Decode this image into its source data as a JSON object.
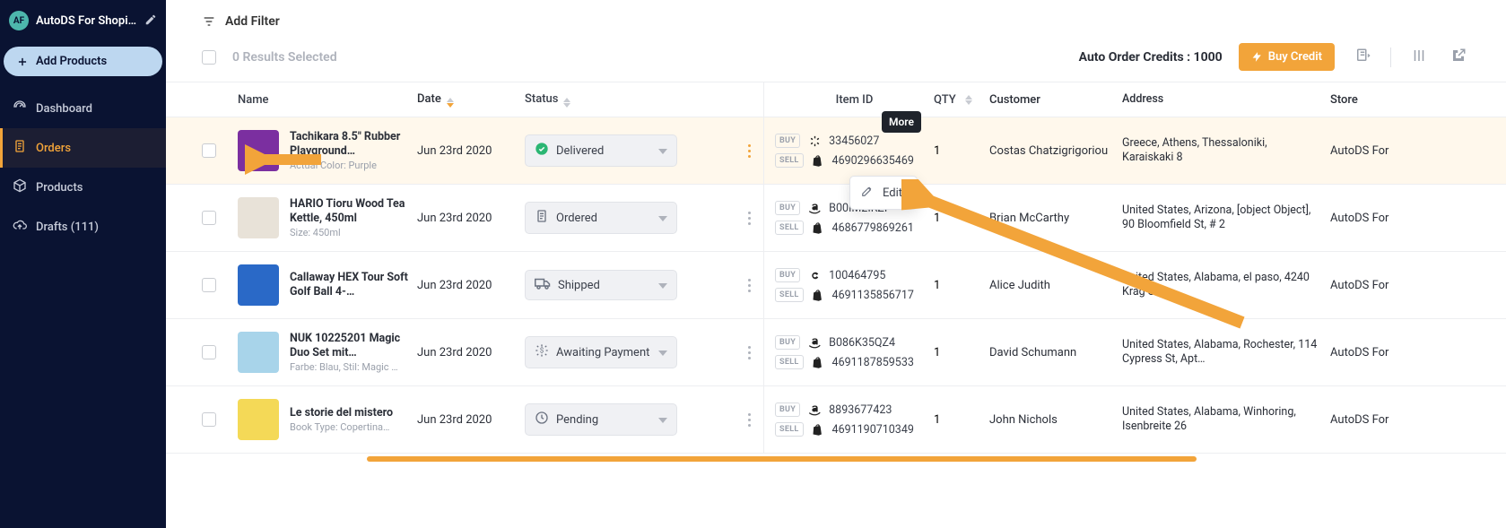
{
  "sidebar": {
    "store_avatar": "AF",
    "store_name": "AutoDS For Shopif...",
    "add_products": "Add Products",
    "items": [
      {
        "label": "Dashboard"
      },
      {
        "label": "Orders"
      },
      {
        "label": "Products"
      },
      {
        "label": "Drafts (111)"
      }
    ]
  },
  "toolbar": {
    "add_filter": "Add Filter",
    "results_selected": "0 Results Selected",
    "credits_label": "Auto Order Credits : 1000",
    "buy_credit": "Buy Credit"
  },
  "tooltip_more": "More",
  "popover_edit": "Edit",
  "columns": {
    "name": "Name",
    "date": "Date",
    "status": "Status",
    "item_id": "Item ID",
    "qty": "QTY",
    "customer": "Customer",
    "address": "Address",
    "store": "Store"
  },
  "tags": {
    "buy": "BUY",
    "sell": "SELL"
  },
  "rows": [
    {
      "name": "Tachikara 8.5\" Rubber Playground…",
      "meta": "Actual Color: Purple",
      "date": "Jun 23rd 2020",
      "status": "Delivered",
      "status_type": "delivered",
      "buy_source": "walmart",
      "buy_id": "33456027",
      "sell_id": "4690296635469",
      "qty": "1",
      "customer": "Costas Chatzigrigoriou",
      "address": "Greece, Athens, Thessaloniki, Karaiskaki 8",
      "store": "AutoDS For",
      "thumb_color": "#7b2fa0"
    },
    {
      "name": "HARIO Tioru Wood Tea Kettle, 450ml",
      "meta": "Size: 450ml",
      "date": "Jun 23rd 2020",
      "status": "Ordered",
      "status_type": "ordered",
      "buy_source": "amazon",
      "buy_id": "B00IM2IRZI",
      "sell_id": "4686779869261",
      "qty": "1",
      "customer": "Brian McCarthy",
      "address": "United States, Arizona, [object Object], 90 Bloomfield St, # 2",
      "store": "AutoDS For",
      "thumb_color": "#e8e2d8"
    },
    {
      "name": "Callaway HEX Tour Soft Golf Ball 4-…",
      "meta": "",
      "date": "Jun 23rd 2020",
      "status": "Shipped",
      "status_type": "shipped",
      "buy_source": "chewy",
      "buy_id": "100464795",
      "sell_id": "4691135856717",
      "qty": "1",
      "customer": "Alice Judith",
      "address": "United States, Alabama, el paso, 4240 Krag St",
      "store": "AutoDS For",
      "thumb_color": "#2a69c7"
    },
    {
      "name": "NUK 10225201 Magic Duo Set mit…",
      "meta": "Farbe: Blau, Stil: Magic …",
      "date": "Jun 23rd 2020",
      "status": "Awaiting Payment",
      "status_type": "awaiting",
      "buy_source": "amazon",
      "buy_id": "B086K35QZ4",
      "sell_id": "4691187859533",
      "qty": "1",
      "customer": "David Schumann",
      "address": "United States, Alabama, Rochester, 114 Cypress St, Apt…",
      "store": "AutoDS For",
      "thumb_color": "#a8d4ea"
    },
    {
      "name": "Le storie del mistero",
      "meta": "Book Type: Copertina…",
      "date": "Jun 23rd 2020",
      "status": "Pending",
      "status_type": "pending",
      "buy_source": "amazon",
      "buy_id": "8893677423",
      "sell_id": "4691190710349",
      "qty": "1",
      "customer": "John Nichols",
      "address": "United States, Alabama, Winhoring, Isenbreite 26",
      "store": "AutoDS For",
      "thumb_color": "#f4d957"
    }
  ]
}
